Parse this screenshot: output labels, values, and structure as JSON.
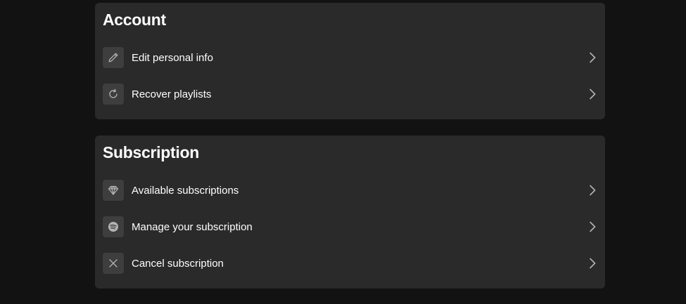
{
  "account": {
    "title": "Account",
    "items": [
      {
        "label": "Edit personal info",
        "icon": "pencil-icon"
      },
      {
        "label": "Recover playlists",
        "icon": "refresh-icon"
      }
    ]
  },
  "subscription": {
    "title": "Subscription",
    "items": [
      {
        "label": "Available subscriptions",
        "icon": "diamond-icon"
      },
      {
        "label": "Manage your subscription",
        "icon": "spotify-icon"
      },
      {
        "label": "Cancel subscription",
        "icon": "close-icon"
      }
    ]
  },
  "colors": {
    "page_background": "#121212",
    "card_background": "#2a2a2a",
    "icon_box_background": "#3e3e3e",
    "text": "#ffffff",
    "icon": "#b3b3b3"
  }
}
